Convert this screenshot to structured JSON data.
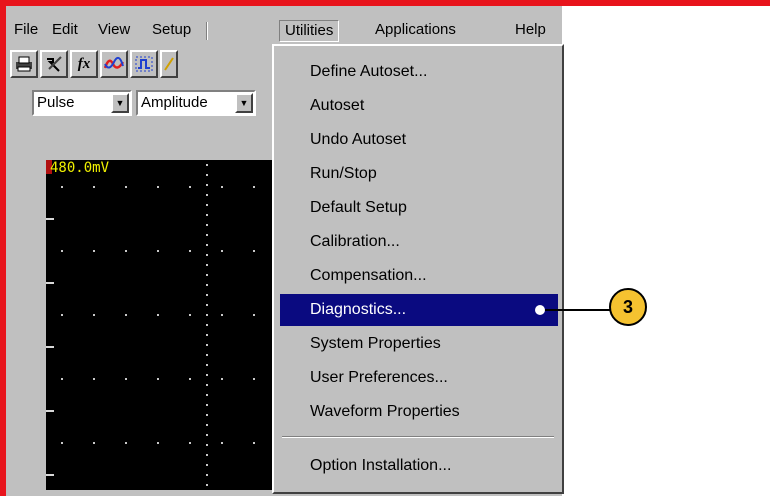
{
  "menubar": {
    "items": [
      "File",
      "Edit",
      "View",
      "Setup",
      "Utilities",
      "Applications",
      "Help"
    ],
    "active": "Utilities"
  },
  "toolbar": {
    "icons": [
      "printer-icon",
      "tools-icon",
      "function-icon",
      "waveform-icon",
      "pulse-icon",
      "edge-icon"
    ],
    "fx_label": "fx"
  },
  "selectors": {
    "first": "Pulse",
    "second": "Amplitude"
  },
  "scope": {
    "scale_label": "480.0mV",
    "colors": {
      "background": "#000000",
      "label": "#f0f000"
    }
  },
  "utilities_menu": {
    "items": [
      "Define Autoset...",
      "Autoset",
      "Undo Autoset",
      "Run/Stop",
      "Default Setup",
      "Calibration...",
      "Compensation...",
      "Diagnostics...",
      "System Properties",
      "User Preferences...",
      "Waveform Properties",
      "Option Installation..."
    ],
    "highlighted": "Diagnostics...",
    "highlight_color": "#0a0a80"
  },
  "callout": {
    "number": "3",
    "color": "#f5c230"
  },
  "frame": {
    "border_color": "#e8141c"
  }
}
